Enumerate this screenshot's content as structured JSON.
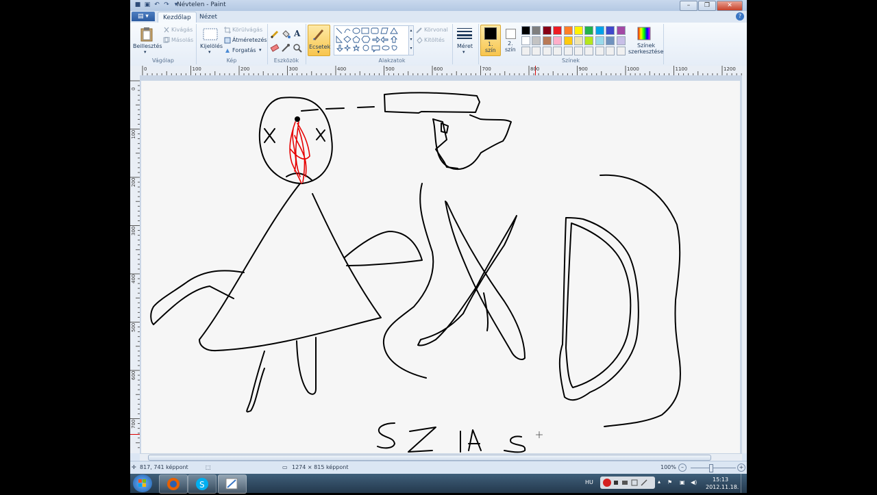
{
  "window": {
    "title": "Névtelen - Paint",
    "buttons": [
      "–",
      "❐",
      "✕"
    ]
  },
  "tabs": {
    "file": "▤ ▾",
    "home": "Kezdőlap",
    "view": "Nézet"
  },
  "ribbon": {
    "clipboard": {
      "paste": "Beillesztés",
      "cut": "Kivágás",
      "copy": "Másolás",
      "label": "Vágólap"
    },
    "image": {
      "select": "Kijelölés",
      "crop": "Körülvágás",
      "resize": "Átméretezés",
      "rotate": "Forgatás",
      "label": "Kép"
    },
    "tools": {
      "label": "Eszközök"
    },
    "brushes": {
      "label": "Ecsetek"
    },
    "shapes": {
      "outline": "Körvonal",
      "fill": "Kitöltés",
      "label": "Alakzatok"
    },
    "size": {
      "label": "Méret"
    },
    "colors": {
      "color1_line1": "1.",
      "color1_line2": "szín",
      "color2_line1": "2.",
      "color2_line2": "szín",
      "edit_line1": "Színek",
      "edit_line2": "szerkesztése",
      "label": "Színek",
      "color1": "#000000",
      "color2": "#ffffff",
      "palette": [
        "#000000",
        "#7f7f7f",
        "#880015",
        "#ed1c24",
        "#ff7f27",
        "#fff200",
        "#22b14c",
        "#00a2e8",
        "#3f48cc",
        "#a349a4",
        "#ffffff",
        "#c3c3c3",
        "#b97a57",
        "#ffaec9",
        "#ffc90e",
        "#efe4b0",
        "#b5e61d",
        "#99d9ea",
        "#7092be",
        "#c8bfe7",
        "#f0f0f0",
        "#f0f0f0",
        "#f0f0f0",
        "#f0f0f0",
        "#f0f0f0",
        "#f0f0f0",
        "#f0f0f0",
        "#f0f0f0",
        "#f0f0f0",
        "#f0f0f0"
      ]
    }
  },
  "rulers": {
    "h": [
      "0",
      "100",
      "200",
      "300",
      "400",
      "500",
      "600",
      "700",
      "800",
      "900",
      "1000",
      "1100",
      "1200"
    ],
    "v": [
      "0",
      "100",
      "200",
      "300",
      "400",
      "500",
      "600",
      "700"
    ]
  },
  "canvas": {
    "text": "SZIA"
  },
  "status": {
    "cursor": "817, 741 képpont",
    "size": "1274 × 815 képpont",
    "zoom": "100%",
    "minus": "–",
    "plus": "+"
  },
  "taskbar": {
    "lang": "HU",
    "time": "15:13",
    "date": "2012.11.18."
  }
}
